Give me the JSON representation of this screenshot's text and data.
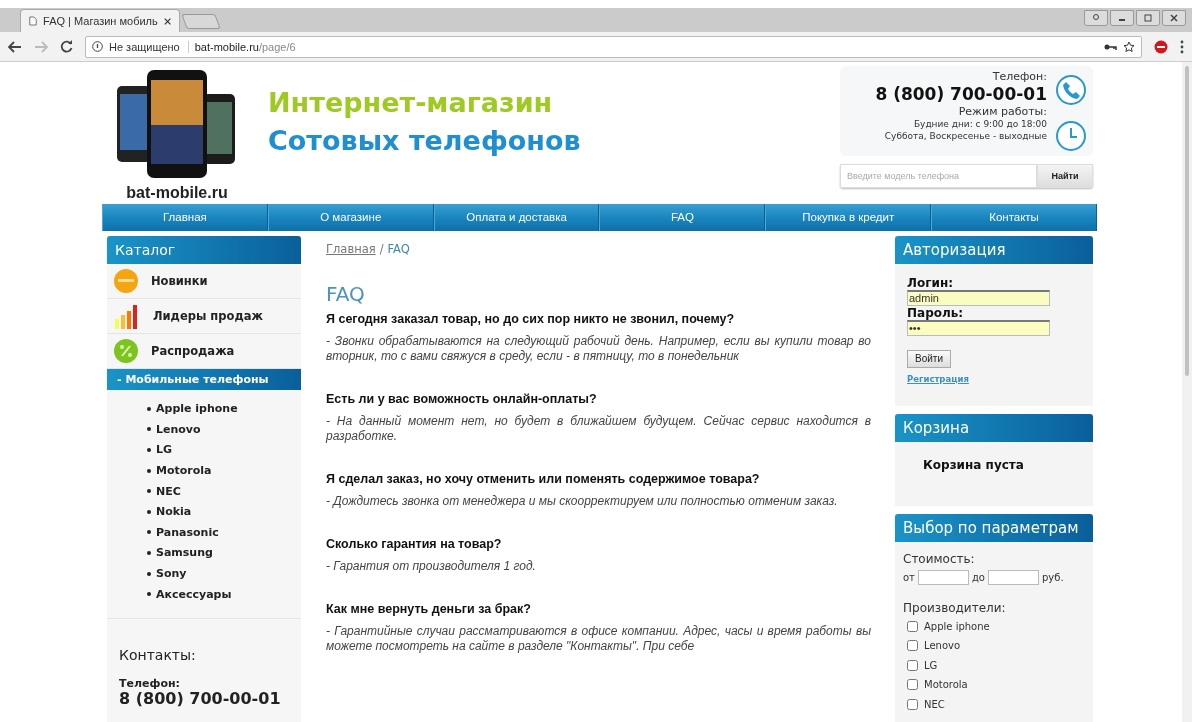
{
  "browser": {
    "tab_title": "FAQ | Магазин мобиль",
    "security": "Не защищено",
    "url_host": "bat-mobile.ru",
    "url_path": "/page/6"
  },
  "header": {
    "site_name": "bat-mobile.ru",
    "slogan_top": "Интернет-магазин",
    "slogan_bottom": "Сотовых телефонов",
    "phone_label": "Телефон:",
    "phone": "8 (800) 700-00-01",
    "hours_label": "Режим работы:",
    "hours": [
      "Будние дни: с 9:00 до 18:00",
      "Суббота, Воскресенье - выходные"
    ],
    "search": {
      "placeholder": "Введите модель телефона",
      "button": "Найти"
    }
  },
  "nav": [
    "Главная",
    "О магазине",
    "Оплата и доставка",
    "FAQ",
    "Покупка в кредит",
    "Контакты"
  ],
  "catalog": {
    "title": "Каталог",
    "items": [
      "Новинки",
      "Лидеры продаж",
      "Распродажа"
    ],
    "category": {
      "label": "- Мобильные телефоны",
      "expanded": true,
      "children": [
        "Apple iphone",
        "Lenovo",
        "LG",
        "Motorola",
        "NEC",
        "Nokia",
        "Panasonic",
        "Samsung",
        "Sony",
        "Аксессуары"
      ]
    }
  },
  "contacts": {
    "title": "Контакты:",
    "phone_label": "Телефон:",
    "phone": "8 (800) 700-00-01"
  },
  "breadcrumb": {
    "home": "Главная",
    "separator": "/",
    "current": "FAQ"
  },
  "page_title": "FAQ",
  "faq": [
    {
      "question": "Я сегодня заказал товар, но до сих пор никто не звонил, почему?",
      "answer": "- Звонки обрабатываются на следующий рабочий день. Например, если вы купили товар во вторник, то с вами свяжуся в среду, если - в пятницу, то в понедельник"
    },
    {
      "question": "Есть ли у вас воможность онлайн-оплаты?",
      "answer": "- На данный момент нет, но будет в ближайшем будущем. Сейчас сервис находится в разработке."
    },
    {
      "question": "Я сделал заказ, но хочу отменить или поменять содержимое товара?",
      "answer": "- Дождитесь звонка от менеджера и мы скоорректируем или полностью отменим заказ."
    },
    {
      "question": "Сколько гарантия на товар?",
      "answer": "- Гарантия от производителя 1 год."
    },
    {
      "question": "Как мне вернуть деньги за брак?",
      "answer": "- Гарантийные случаи рассматриваются в офисе компании. Адрес, часы и время работы вы можете посмотреть на сайте в разделе \"Контакты\". При себе"
    }
  ],
  "auth": {
    "title": "Авторизация",
    "login_label": "Логин:",
    "login": "admin",
    "password_label": "Пароль:",
    "password": "•••",
    "button": "Войти",
    "register": "Регистрация"
  },
  "cart": {
    "title": "Корзина",
    "empty": "Корзина пуста"
  },
  "filter": {
    "title": "Выбор по параметрам",
    "price_label": "Стоимость:",
    "from": "от",
    "to": "до",
    "currency": "руб.",
    "makers_label": "Производители:",
    "makers": [
      {
        "label": "Apple iphone",
        "checked": false
      },
      {
        "label": "Lenovo",
        "checked": false
      },
      {
        "label": "LG",
        "checked": false
      },
      {
        "label": "Motorola",
        "checked": false
      },
      {
        "label": "NEC",
        "checked": false
      }
    ]
  }
}
